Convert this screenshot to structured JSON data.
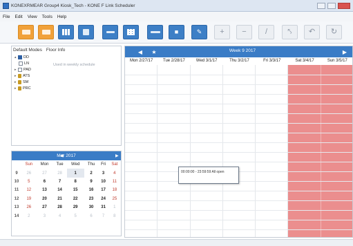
{
  "window": {
    "title": "KONEXRMEAR Group4 Kiosk_Tech - KONE F Link Scheduler"
  },
  "menu": [
    "File",
    "Edit",
    "View",
    "Tools",
    "Help"
  ],
  "toolbar": {
    "buttons": [
      {
        "icon": "calendar-icon",
        "style": "orange"
      },
      {
        "icon": "calendar-week-icon",
        "style": "orange"
      },
      {
        "icon": "columns-icon",
        "style": "blue"
      },
      {
        "icon": "save-icon",
        "style": "blue"
      },
      {
        "icon": "list-icon",
        "style": "blue"
      },
      {
        "icon": "grid-icon",
        "style": "blue"
      },
      {
        "icon": "bar-icon",
        "style": "blue"
      },
      {
        "icon": "lock-icon",
        "style": "blue"
      },
      {
        "icon": "edit-icon",
        "style": "blue"
      },
      {
        "icon": "add-icon",
        "style": "gray"
      },
      {
        "icon": "remove-icon",
        "style": "gray"
      },
      {
        "icon": "wrench-icon",
        "style": "gray"
      },
      {
        "icon": "split-icon",
        "style": "gray"
      },
      {
        "icon": "undo-icon",
        "style": "gray"
      },
      {
        "icon": "refresh-icon",
        "style": "gray"
      }
    ]
  },
  "sidebar": {
    "tabs": [
      "Default Modes",
      "Floor Info"
    ],
    "tree": [
      {
        "label": "DD",
        "checked": true
      },
      {
        "label": "LN",
        "checked": false
      },
      {
        "label": "PAD",
        "checked": false
      },
      {
        "label": "ATS",
        "checked": false
      },
      {
        "label": "SM",
        "checked": false
      },
      {
        "label": "PRC",
        "checked": false
      }
    ],
    "hint": "Used in weekly schedule"
  },
  "mini_calendar": {
    "month_label": "Mar 2017",
    "weekdays": [
      "Sun",
      "Mon",
      "Tue",
      "Wed",
      "Thu",
      "Fri",
      "Sat"
    ],
    "weeks": [
      {
        "wk": "9",
        "days": [
          "26",
          "27",
          "28",
          "1",
          "2",
          "3",
          "4"
        ]
      },
      {
        "wk": "10",
        "days": [
          "5",
          "6",
          "7",
          "8",
          "9",
          "10",
          "11"
        ]
      },
      {
        "wk": "11",
        "days": [
          "12",
          "13",
          "14",
          "15",
          "16",
          "17",
          "18"
        ]
      },
      {
        "wk": "12",
        "days": [
          "19",
          "20",
          "21",
          "22",
          "23",
          "24",
          "25"
        ]
      },
      {
        "wk": "13",
        "days": [
          "26",
          "27",
          "28",
          "29",
          "30",
          "31",
          "1"
        ]
      },
      {
        "wk": "14",
        "days": [
          "2",
          "3",
          "4",
          "5",
          "6",
          "7",
          "8"
        ]
      }
    ]
  },
  "schedule": {
    "week_label": "Week 9 2017",
    "days": [
      "Mon 2/27/17",
      "Tue 2/28/17",
      "Wed 3/1/17",
      "Thu 3/2/17",
      "Fri 3/3/17",
      "Sat 3/4/17",
      "Sun 3/5/17"
    ],
    "weekend_color": "#eb8e8e",
    "event": "00:00:00 - 23:59:59 All open"
  },
  "colors": {
    "accent": "#3a7cc6",
    "orange": "#f1a13a"
  }
}
